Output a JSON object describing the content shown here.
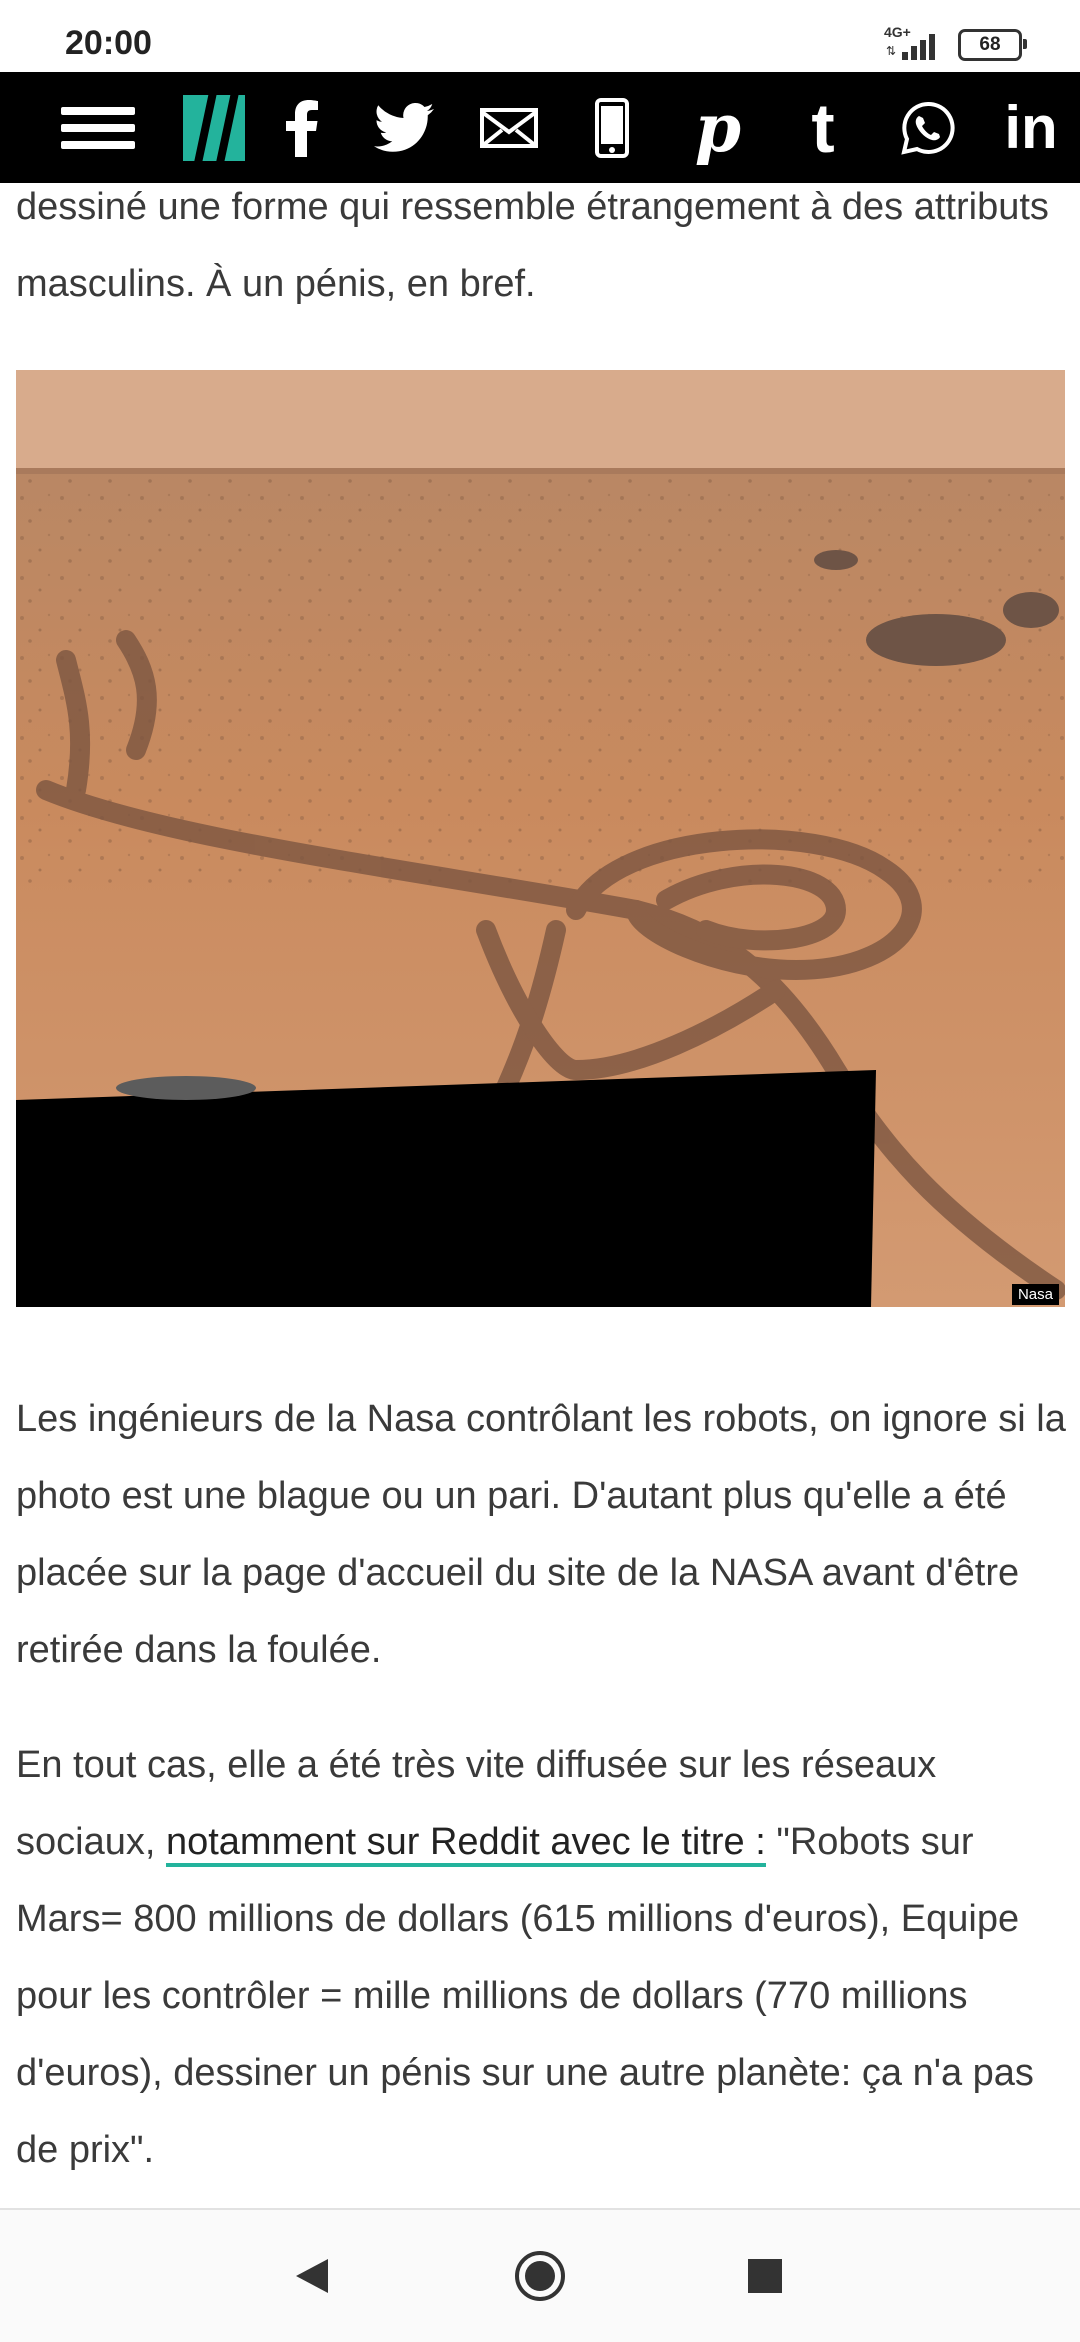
{
  "status_bar": {
    "time": "20:00",
    "network_label": "4G+",
    "battery_level": "68"
  },
  "share_toolbar": {
    "icons": [
      "menu-icon",
      "huffpost-logo-icon",
      "facebook-icon",
      "twitter-icon",
      "email-icon",
      "mobile-icon",
      "pinterest-icon",
      "tumblr-icon",
      "whatsapp-icon",
      "linkedin-icon"
    ]
  },
  "article": {
    "paragraph_top": "dessiné une forme qui ressemble étrangement à des attributs masculins. À un pénis, en bref.",
    "image_credit": "Nasa",
    "paragraph_2": "Les ingénieurs de la Nasa contrôlant les robots, on ignore si la photo est une blague ou un pari. D'autant plus qu'elle a été placée sur la page d'accueil du site de la NASA avant d'être retirée dans la foulée.",
    "paragraph_3_start": "En tout cas, elle a été très vite diffusée sur les réseaux sociaux, ",
    "paragraph_3_link": "notamment sur Reddit avec le titre :",
    "paragraph_3_end": " \"Robots sur Mars= 800 millions de dollars (615 millions d'euros), Equipe pour les contrôler = mille millions de dollars (770 millions d'euros), dessiner un pénis sur une autre planète: ça n'a pas de prix\"."
  },
  "colors": {
    "accent": "#23b39c",
    "toolbar_bg": "#000000",
    "text": "#3a3a3a",
    "mars_ground": "#c98a5e",
    "mars_sky": "#d8ab8c"
  },
  "nav_bar": {
    "icons": [
      "back-icon",
      "home-icon",
      "recents-icon"
    ]
  }
}
